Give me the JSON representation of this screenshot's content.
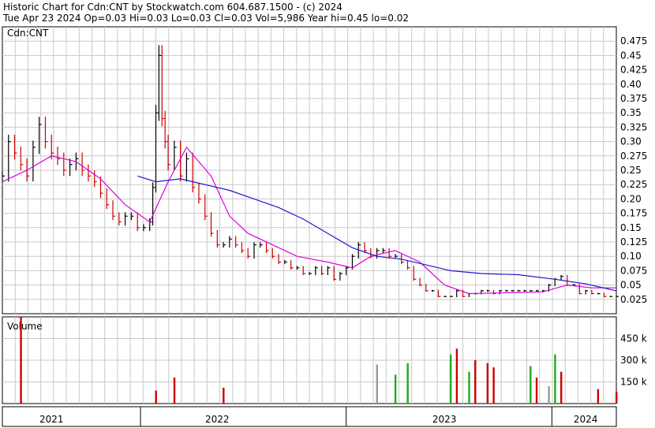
{
  "header": {
    "line1": "Historic Chart for Cdn:CNT by Stockwatch.com 604.687.1500 - (c) 2024",
    "line2": "Tue Apr 23 2024  Op=0.03  Hi=0.03  Lo=0.03  Cl=0.03  Vol=5,986  Year hi=0.45  lo=0.02"
  },
  "colors": {
    "up": "#cc0000",
    "down": "#000000",
    "ma_short": "#dd00dd",
    "ma_long": "#1a1acc",
    "grid": "#c8c8c8",
    "vol_red": "#cc0000",
    "vol_green": "#22aa22",
    "vol_gray": "#999999"
  },
  "chart_data": [
    {
      "type": "ohlc",
      "legend": "Cdn:CNT",
      "ylim": [
        0,
        0.5
      ],
      "y_ticks": [
        "0.475",
        "0.45",
        "0.425",
        "0.40",
        "0.375",
        "0.35",
        "0.325",
        "0.30",
        "0.275",
        "0.25",
        "0.225",
        "0.20",
        "0.175",
        "0.15",
        "0.125",
        "0.10",
        "0.075",
        "0.05",
        "0.025"
      ],
      "x_ticks": [
        "2021",
        "2022",
        "2023",
        "2024"
      ],
      "grid": true,
      "price_series": [
        {
          "x": 0.0,
          "y": 0.24
        },
        {
          "x": 0.01,
          "y": 0.3
        },
        {
          "x": 0.02,
          "y": 0.28
        },
        {
          "x": 0.03,
          "y": 0.26
        },
        {
          "x": 0.04,
          "y": 0.24
        },
        {
          "x": 0.05,
          "y": 0.29
        },
        {
          "x": 0.06,
          "y": 0.33
        },
        {
          "x": 0.07,
          "y": 0.3
        },
        {
          "x": 0.08,
          "y": 0.28
        },
        {
          "x": 0.09,
          "y": 0.27
        },
        {
          "x": 0.1,
          "y": 0.25
        },
        {
          "x": 0.11,
          "y": 0.26
        },
        {
          "x": 0.12,
          "y": 0.27
        },
        {
          "x": 0.13,
          "y": 0.25
        },
        {
          "x": 0.14,
          "y": 0.24
        },
        {
          "x": 0.15,
          "y": 0.23
        },
        {
          "x": 0.16,
          "y": 0.21
        },
        {
          "x": 0.17,
          "y": 0.19
        },
        {
          "x": 0.18,
          "y": 0.17
        },
        {
          "x": 0.19,
          "y": 0.16
        },
        {
          "x": 0.2,
          "y": 0.17
        },
        {
          "x": 0.21,
          "y": 0.17
        },
        {
          "x": 0.22,
          "y": 0.15
        },
        {
          "x": 0.23,
          "y": 0.15
        },
        {
          "x": 0.24,
          "y": 0.16
        },
        {
          "x": 0.245,
          "y": 0.22
        },
        {
          "x": 0.25,
          "y": 0.35
        },
        {
          "x": 0.255,
          "y": 0.45
        },
        {
          "x": 0.26,
          "y": 0.34
        },
        {
          "x": 0.265,
          "y": 0.3
        },
        {
          "x": 0.27,
          "y": 0.26
        },
        {
          "x": 0.28,
          "y": 0.29
        },
        {
          "x": 0.29,
          "y": 0.24
        },
        {
          "x": 0.3,
          "y": 0.27
        },
        {
          "x": 0.31,
          "y": 0.22
        },
        {
          "x": 0.32,
          "y": 0.2
        },
        {
          "x": 0.33,
          "y": 0.17
        },
        {
          "x": 0.34,
          "y": 0.14
        },
        {
          "x": 0.35,
          "y": 0.12
        },
        {
          "x": 0.36,
          "y": 0.12
        },
        {
          "x": 0.37,
          "y": 0.13
        },
        {
          "x": 0.38,
          "y": 0.12
        },
        {
          "x": 0.39,
          "y": 0.11
        },
        {
          "x": 0.4,
          "y": 0.1
        },
        {
          "x": 0.41,
          "y": 0.12
        },
        {
          "x": 0.42,
          "y": 0.12
        },
        {
          "x": 0.43,
          "y": 0.11
        },
        {
          "x": 0.44,
          "y": 0.1
        },
        {
          "x": 0.45,
          "y": 0.09
        },
        {
          "x": 0.46,
          "y": 0.09
        },
        {
          "x": 0.47,
          "y": 0.08
        },
        {
          "x": 0.48,
          "y": 0.08
        },
        {
          "x": 0.49,
          "y": 0.07
        },
        {
          "x": 0.5,
          "y": 0.07
        },
        {
          "x": 0.51,
          "y": 0.08
        },
        {
          "x": 0.52,
          "y": 0.07
        },
        {
          "x": 0.53,
          "y": 0.08
        },
        {
          "x": 0.54,
          "y": 0.06
        },
        {
          "x": 0.55,
          "y": 0.07
        },
        {
          "x": 0.56,
          "y": 0.08
        },
        {
          "x": 0.57,
          "y": 0.1
        },
        {
          "x": 0.58,
          "y": 0.12
        },
        {
          "x": 0.59,
          "y": 0.11
        },
        {
          "x": 0.6,
          "y": 0.1
        },
        {
          "x": 0.61,
          "y": 0.11
        },
        {
          "x": 0.62,
          "y": 0.11
        },
        {
          "x": 0.63,
          "y": 0.1
        },
        {
          "x": 0.64,
          "y": 0.1
        },
        {
          "x": 0.65,
          "y": 0.09
        },
        {
          "x": 0.66,
          "y": 0.08
        },
        {
          "x": 0.67,
          "y": 0.06
        },
        {
          "x": 0.68,
          "y": 0.05
        },
        {
          "x": 0.69,
          "y": 0.04
        },
        {
          "x": 0.7,
          "y": 0.04
        },
        {
          "x": 0.71,
          "y": 0.03
        },
        {
          "x": 0.72,
          "y": 0.03
        },
        {
          "x": 0.73,
          "y": 0.03
        },
        {
          "x": 0.74,
          "y": 0.04
        },
        {
          "x": 0.75,
          "y": 0.03
        },
        {
          "x": 0.76,
          "y": 0.035
        },
        {
          "x": 0.77,
          "y": 0.035
        },
        {
          "x": 0.78,
          "y": 0.04
        },
        {
          "x": 0.79,
          "y": 0.04
        },
        {
          "x": 0.8,
          "y": 0.035
        },
        {
          "x": 0.81,
          "y": 0.04
        },
        {
          "x": 0.82,
          "y": 0.04
        },
        {
          "x": 0.83,
          "y": 0.04
        },
        {
          "x": 0.84,
          "y": 0.04
        },
        {
          "x": 0.85,
          "y": 0.04
        },
        {
          "x": 0.86,
          "y": 0.04
        },
        {
          "x": 0.87,
          "y": 0.04
        },
        {
          "x": 0.88,
          "y": 0.04
        },
        {
          "x": 0.89,
          "y": 0.05
        },
        {
          "x": 0.9,
          "y": 0.06
        },
        {
          "x": 0.91,
          "y": 0.065
        },
        {
          "x": 0.92,
          "y": 0.05
        },
        {
          "x": 0.93,
          "y": 0.05
        },
        {
          "x": 0.94,
          "y": 0.035
        },
        {
          "x": 0.95,
          "y": 0.04
        },
        {
          "x": 0.96,
          "y": 0.035
        },
        {
          "x": 0.97,
          "y": 0.035
        },
        {
          "x": 0.98,
          "y": 0.03
        },
        {
          "x": 0.99,
          "y": 0.03
        },
        {
          "x": 1.0,
          "y": 0.03
        }
      ],
      "ma_short": [
        {
          "x": 0.0,
          "y": 0.23
        },
        {
          "x": 0.04,
          "y": 0.25
        },
        {
          "x": 0.08,
          "y": 0.275
        },
        {
          "x": 0.12,
          "y": 0.265
        },
        {
          "x": 0.16,
          "y": 0.235
        },
        {
          "x": 0.2,
          "y": 0.19
        },
        {
          "x": 0.24,
          "y": 0.16
        },
        {
          "x": 0.27,
          "y": 0.23
        },
        {
          "x": 0.3,
          "y": 0.29
        },
        {
          "x": 0.34,
          "y": 0.24
        },
        {
          "x": 0.37,
          "y": 0.17
        },
        {
          "x": 0.4,
          "y": 0.14
        },
        {
          "x": 0.44,
          "y": 0.12
        },
        {
          "x": 0.48,
          "y": 0.1
        },
        {
          "x": 0.53,
          "y": 0.09
        },
        {
          "x": 0.57,
          "y": 0.08
        },
        {
          "x": 0.6,
          "y": 0.1
        },
        {
          "x": 0.64,
          "y": 0.11
        },
        {
          "x": 0.68,
          "y": 0.09
        },
        {
          "x": 0.72,
          "y": 0.05
        },
        {
          "x": 0.76,
          "y": 0.035
        },
        {
          "x": 0.8,
          "y": 0.036
        },
        {
          "x": 0.84,
          "y": 0.037
        },
        {
          "x": 0.88,
          "y": 0.038
        },
        {
          "x": 0.92,
          "y": 0.05
        },
        {
          "x": 0.96,
          "y": 0.045
        },
        {
          "x": 1.0,
          "y": 0.045
        }
      ],
      "ma_long": [
        {
          "x": 0.22,
          "y": 0.24
        },
        {
          "x": 0.25,
          "y": 0.23
        },
        {
          "x": 0.29,
          "y": 0.235
        },
        {
          "x": 0.33,
          "y": 0.225
        },
        {
          "x": 0.37,
          "y": 0.215
        },
        {
          "x": 0.41,
          "y": 0.2
        },
        {
          "x": 0.45,
          "y": 0.185
        },
        {
          "x": 0.49,
          "y": 0.165
        },
        {
          "x": 0.53,
          "y": 0.14
        },
        {
          "x": 0.57,
          "y": 0.115
        },
        {
          "x": 0.61,
          "y": 0.1
        },
        {
          "x": 0.65,
          "y": 0.095
        },
        {
          "x": 0.69,
          "y": 0.085
        },
        {
          "x": 0.73,
          "y": 0.075
        },
        {
          "x": 0.78,
          "y": 0.07
        },
        {
          "x": 0.84,
          "y": 0.068
        },
        {
          "x": 0.9,
          "y": 0.06
        },
        {
          "x": 0.95,
          "y": 0.052
        },
        {
          "x": 1.0,
          "y": 0.04
        }
      ]
    },
    {
      "type": "bar",
      "legend": "Volume",
      "ylim": [
        0,
        600000
      ],
      "y_ticks": [
        "450 k",
        "300 k",
        "150 k"
      ],
      "volumes": [
        {
          "x": 0.03,
          "v": 600000,
          "c": "red"
        },
        {
          "x": 0.25,
          "v": 90000,
          "c": "red"
        },
        {
          "x": 0.28,
          "v": 180000,
          "c": "red"
        },
        {
          "x": 0.36,
          "v": 110000,
          "c": "red"
        },
        {
          "x": 0.61,
          "v": 270000,
          "c": "gray"
        },
        {
          "x": 0.64,
          "v": 200000,
          "c": "green"
        },
        {
          "x": 0.66,
          "v": 280000,
          "c": "green"
        },
        {
          "x": 0.73,
          "v": 340000,
          "c": "green"
        },
        {
          "x": 0.74,
          "v": 380000,
          "c": "red"
        },
        {
          "x": 0.76,
          "v": 220000,
          "c": "green"
        },
        {
          "x": 0.77,
          "v": 300000,
          "c": "red"
        },
        {
          "x": 0.79,
          "v": 280000,
          "c": "red"
        },
        {
          "x": 0.8,
          "v": 250000,
          "c": "red"
        },
        {
          "x": 0.86,
          "v": 260000,
          "c": "green"
        },
        {
          "x": 0.87,
          "v": 180000,
          "c": "red"
        },
        {
          "x": 0.89,
          "v": 120000,
          "c": "gray"
        },
        {
          "x": 0.9,
          "v": 340000,
          "c": "green"
        },
        {
          "x": 0.91,
          "v": 220000,
          "c": "red"
        },
        {
          "x": 0.97,
          "v": 100000,
          "c": "red"
        },
        {
          "x": 1.0,
          "v": 80000,
          "c": "red"
        }
      ]
    }
  ]
}
